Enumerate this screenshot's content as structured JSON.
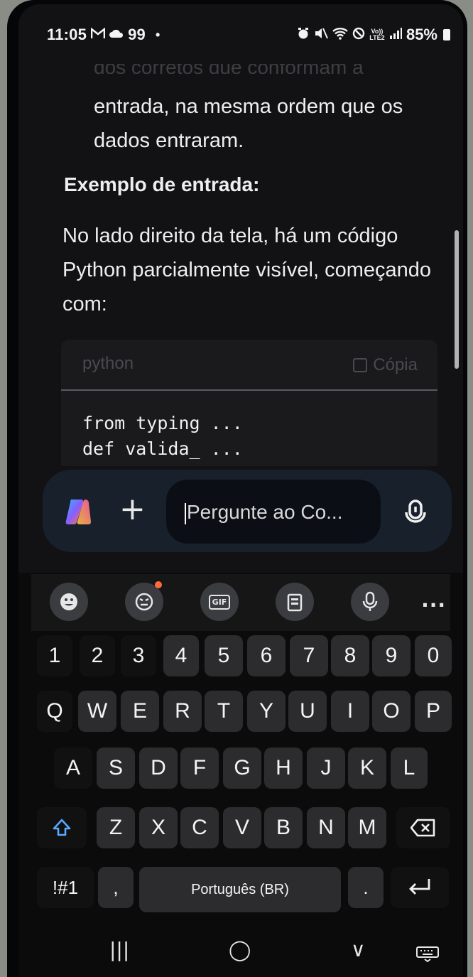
{
  "status_bar": {
    "time": "11:05",
    "notif_icons": [
      "gmail-icon",
      "cloud-icon",
      "99"
    ],
    "dot": "•",
    "system_icons": [
      "alarm-icon",
      "mute-icon",
      "wifi-icon",
      "blocked-icon",
      "volte-icon",
      "signal-icon"
    ],
    "volte": "Vo)) LTE2",
    "battery": "85%"
  },
  "chat": {
    "faded_line": "dos corretos que conformam a",
    "paragraph_1": "entrada, na mesma ordem que os dados entraram.",
    "heading": "Exemplo de entrada:",
    "paragraph_2": "No lado direito da tela, há um código Python parcialmente visível, começando com:",
    "code_block": {
      "language": "python",
      "copy_label": "Cópia",
      "lines": [
        "from typing ...",
        "def valida_ ..."
      ]
    }
  },
  "composer": {
    "placeholder": "Pergunte ao Co...",
    "plus_label": "+",
    "icons": [
      "copilot-logo-icon",
      "plus-icon",
      "microphone-icon"
    ]
  },
  "keyboard": {
    "toolbar": [
      "emoji-icon",
      "sticker-icon",
      "gif-icon",
      "clipboard-icon",
      "voice-input-icon",
      "more-icon"
    ],
    "toolbar_more": "...",
    "toolbar_gif": "GIF",
    "number_row": [
      "1",
      "2",
      "3",
      "4",
      "5",
      "6",
      "7",
      "8",
      "9",
      "0"
    ],
    "row_1": [
      "Q",
      "W",
      "E",
      "R",
      "T",
      "Y",
      "U",
      "I",
      "O",
      "P"
    ],
    "row_2": [
      "A",
      "S",
      "D",
      "F",
      "G",
      "H",
      "J",
      "K",
      "L"
    ],
    "row_3": [
      "Z",
      "X",
      "C",
      "V",
      "B",
      "N",
      "M"
    ],
    "symbols_key": "!#1",
    "comma_key": ",",
    "space_label": "Português (BR)",
    "period_key": ".",
    "shift_icon": "shift-icon",
    "backspace_icon": "backspace-icon",
    "enter_icon": "enter-icon"
  },
  "nav_bar": {
    "recents": "|||",
    "home": "◯",
    "back": "∨",
    "keyboard_icon": "keyboard-hide-icon"
  },
  "colors": {
    "screen_bg": "#121214",
    "key_bg": "#2c2c2e",
    "composer_bg": "#17202b",
    "notification_dot": "#ff6a3d"
  }
}
